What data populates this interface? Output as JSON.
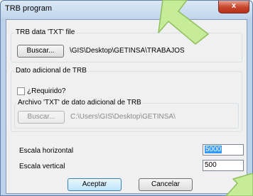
{
  "window": {
    "title": "TRB program",
    "close_glyph": "x"
  },
  "trb_group": {
    "label": "TRB data 'TXT' file",
    "browse_button": "Buscar...",
    "path": "\\GIS\\Desktop\\GETINSA\\TRABAJOS"
  },
  "additional_group": {
    "label": "Dato adicional de TRB",
    "required_checkbox": {
      "label": "¿Requirido?",
      "checked": false
    },
    "file_group": {
      "label": "Archivo 'TXT' de dato adicional de TRB",
      "browse_button": "Buscar...",
      "path": "C:\\Users\\GIS\\Desktop\\GETINSA\\"
    }
  },
  "scales": {
    "horizontal": {
      "label": "Escala horizontal",
      "value": "5000"
    },
    "vertical": {
      "label": "Escala vertical",
      "value": "500"
    }
  },
  "buttons": {
    "accept": "Aceptar",
    "cancel": "Cancelar"
  },
  "colors": {
    "arrow_fill": "#c6ec9a",
    "arrow_stroke": "#8fbf5a",
    "selection": "#3399ff"
  },
  "icons": [
    "close-icon",
    "arrow-down-left-icon",
    "arrow-up-right-icon"
  ]
}
